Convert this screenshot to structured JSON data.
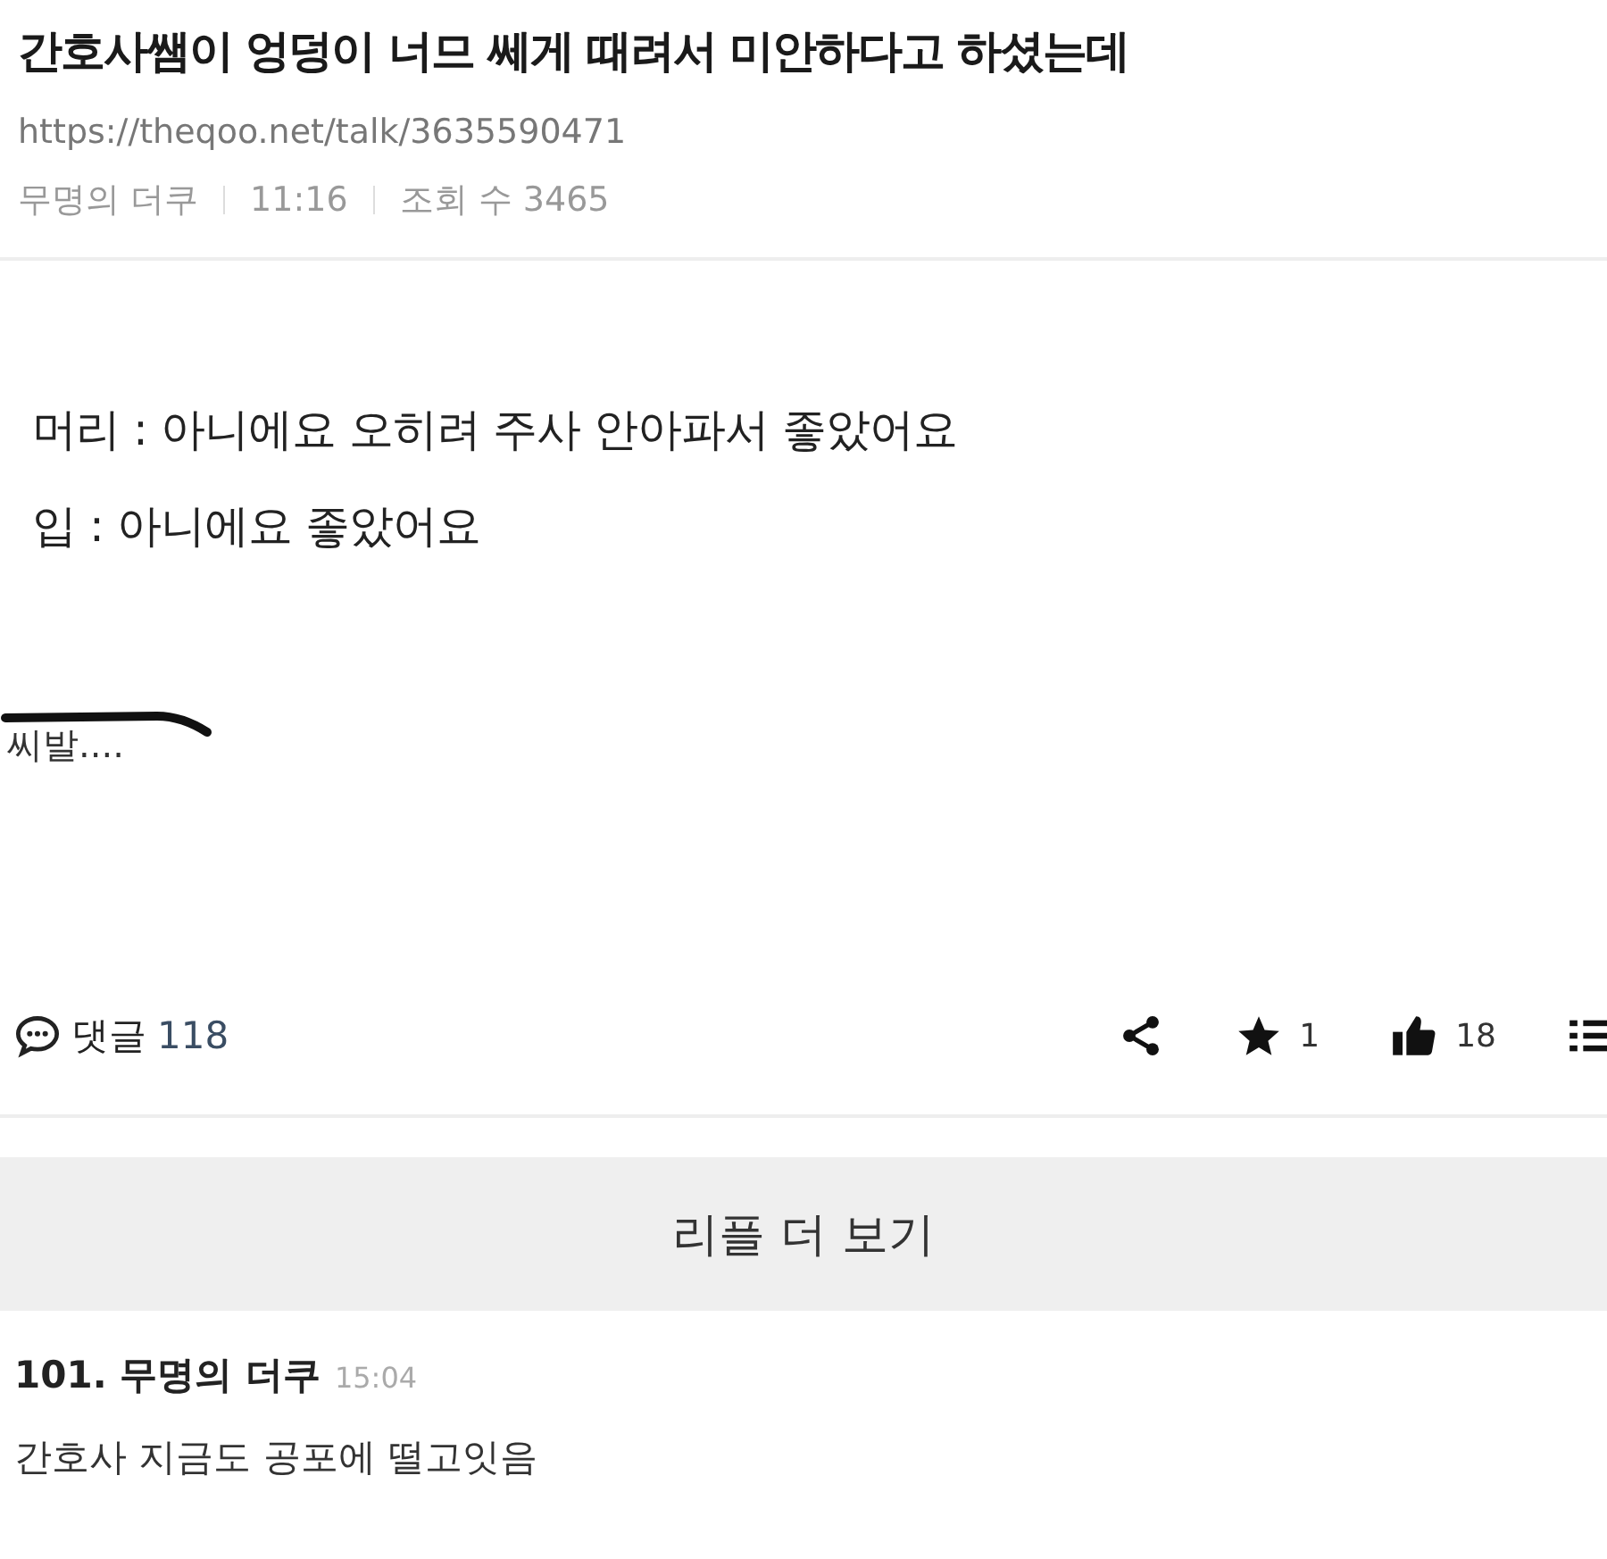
{
  "post": {
    "title": "간호사쌤이 엉덩이 너므 쎄게 때려서 미안하다고 하셨는데",
    "url": "https://theqoo.net/talk/3635590471",
    "author": "무명의 더쿠",
    "time": "11:16",
    "views": "조회 수 3465",
    "body": [
      "머리 : 아니에요 오히려 주사 안아파서 좋았어요",
      "입 : 아니에요 좋았어요"
    ],
    "scribbled_text": "씨발....",
    "actions": {
      "comments_label": "댓글",
      "comments_count": "118",
      "stars": "1",
      "likes": "18"
    }
  },
  "more_replies": "리플 더 보기",
  "comments": [
    {
      "header": "101. 무명의 더쿠",
      "time": "15:04",
      "text": "간호사 지금도 공포에 떨고잇음"
    }
  ]
}
